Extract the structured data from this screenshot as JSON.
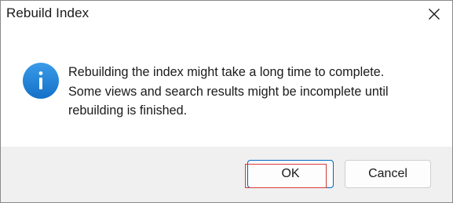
{
  "dialog": {
    "title": "Rebuild Index",
    "close_icon": "close-icon",
    "info_icon": "info-icon",
    "message_lines": [
      "Rebuilding the index might take a long time to complete.",
      "Some views and search results might be incomplete until",
      "rebuilding is finished."
    ],
    "buttons": {
      "ok_label": "OK",
      "cancel_label": "Cancel"
    }
  },
  "colors": {
    "info_blue": "#1e7fd6",
    "accent_border": "#0067c0",
    "highlight_red": "#d93a3a",
    "footer_bg": "#f0f0f0"
  }
}
